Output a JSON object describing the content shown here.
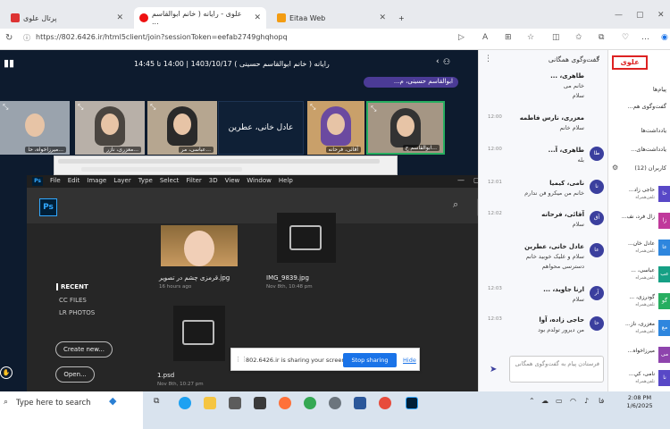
{
  "browser": {
    "tabs": [
      {
        "label": "پرتال علوی"
      },
      {
        "label": "علوی - رایانه ( خانم ابوالقاسم ..."
      },
      {
        "label": "Eitaa Web"
      }
    ],
    "new_tab": "+",
    "url": "https://802.6426.ir/html5client/join?sessionToken=eefab2749ghqhopq"
  },
  "meeting": {
    "title": "رایانه ( خانم ابوالقاسم حسینی ) 1403/10/17 | 14:00 تا 14:45",
    "speaker": "ابوالقاسم حسینی، م...",
    "tiles": [
      {
        "name": "میرزاخواه، حا..."
      },
      {
        "name": "معزری، نازر..."
      },
      {
        "name": "عباسی، مر..."
      },
      {
        "name": "عادل خانی، عطرین"
      },
      {
        "name": "آقائی، فرحانه"
      },
      {
        "name": "ابوالقاسم ح..."
      }
    ]
  },
  "photoshop": {
    "logo": "Ps",
    "menu": [
      "File",
      "Edit",
      "Image",
      "Layer",
      "Type",
      "Select",
      "Filter",
      "3D",
      "View",
      "Window",
      "Help"
    ],
    "nav": [
      "RECENT",
      "CC FILES",
      "LR PHOTOS"
    ],
    "buttons": {
      "create": "Create new...",
      "open": "Open..."
    },
    "files": [
      {
        "name": "قرمزی چشم در تصویر.jpg",
        "date": "16 hours ago"
      },
      {
        "name": "IMG_9839.jpg",
        "date": "Nov 8th, 10:48 pm"
      },
      {
        "name": "1.psd",
        "date": "Nov 8th, 10:27 pm"
      }
    ]
  },
  "sharing": {
    "text": "802.6426.ir is sharing your screen",
    "stop": "Stop sharing",
    "hide": "Hide"
  },
  "chat": {
    "header": "گفت‌وگوی همگانی",
    "messages": [
      {
        "name": "طاهری، ...",
        "time": "",
        "text": "خانم می",
        "text2": "سلام"
      },
      {
        "name": "معزری، نارس فاطمه",
        "time": "12:00",
        "text": "سلام خانم"
      },
      {
        "name": "طاهری، آ...",
        "time": "12:00",
        "text": "بله"
      },
      {
        "name": "نامی، کیمیا",
        "time": "12:01",
        "text": "خانم من میکرو فن ندارم"
      },
      {
        "name": "آقائی، فرحانه",
        "time": "12:02",
        "text": "سلام"
      },
      {
        "name": "عادل خانی، عطرین",
        "time": "",
        "text": "سلام و علیک خوبید خانم",
        "text2": "دسترسی محواهم"
      },
      {
        "name": "ارنا جاوید، ...",
        "time": "12:03",
        "text": "سلام"
      },
      {
        "name": "حاجی زاده، آوا",
        "time": "12:03",
        "text": "من دیرور تولدم بود"
      }
    ],
    "input_placeholder": "فرستادن پیام به گفت‌وگوی همگانی"
  },
  "users": {
    "logo": "علوی",
    "label_messages": "پیام‌ها",
    "label_public": "گفت‌وگوی هم...",
    "label_notes": "یادداشت‌ها",
    "label_shared_notes": "یادداشت‌های...",
    "label_users": "کاربران (12)",
    "list": [
      {
        "name": "حاجی زاد...",
        "sub": "تلفن‌همراه"
      },
      {
        "name": "زال فرد، نف..."
      },
      {
        "name": "عادل خان...",
        "sub": "تلفن‌همراه"
      },
      {
        "name": "عباسی، ...",
        "sub": "تلفن‌همراه"
      },
      {
        "name": "گودرزی، ...",
        "sub": "تلفن‌همراه"
      },
      {
        "name": "معزری، ناز...",
        "sub": "تلفن‌همراه"
      },
      {
        "name": "میرزاخواه..."
      },
      {
        "name": "نامی، کي...",
        "sub": "تلفن‌همراه"
      }
    ]
  },
  "taskbar": {
    "search": "Type here to search",
    "time": "2:08 PM",
    "date": "1/6/2025"
  }
}
